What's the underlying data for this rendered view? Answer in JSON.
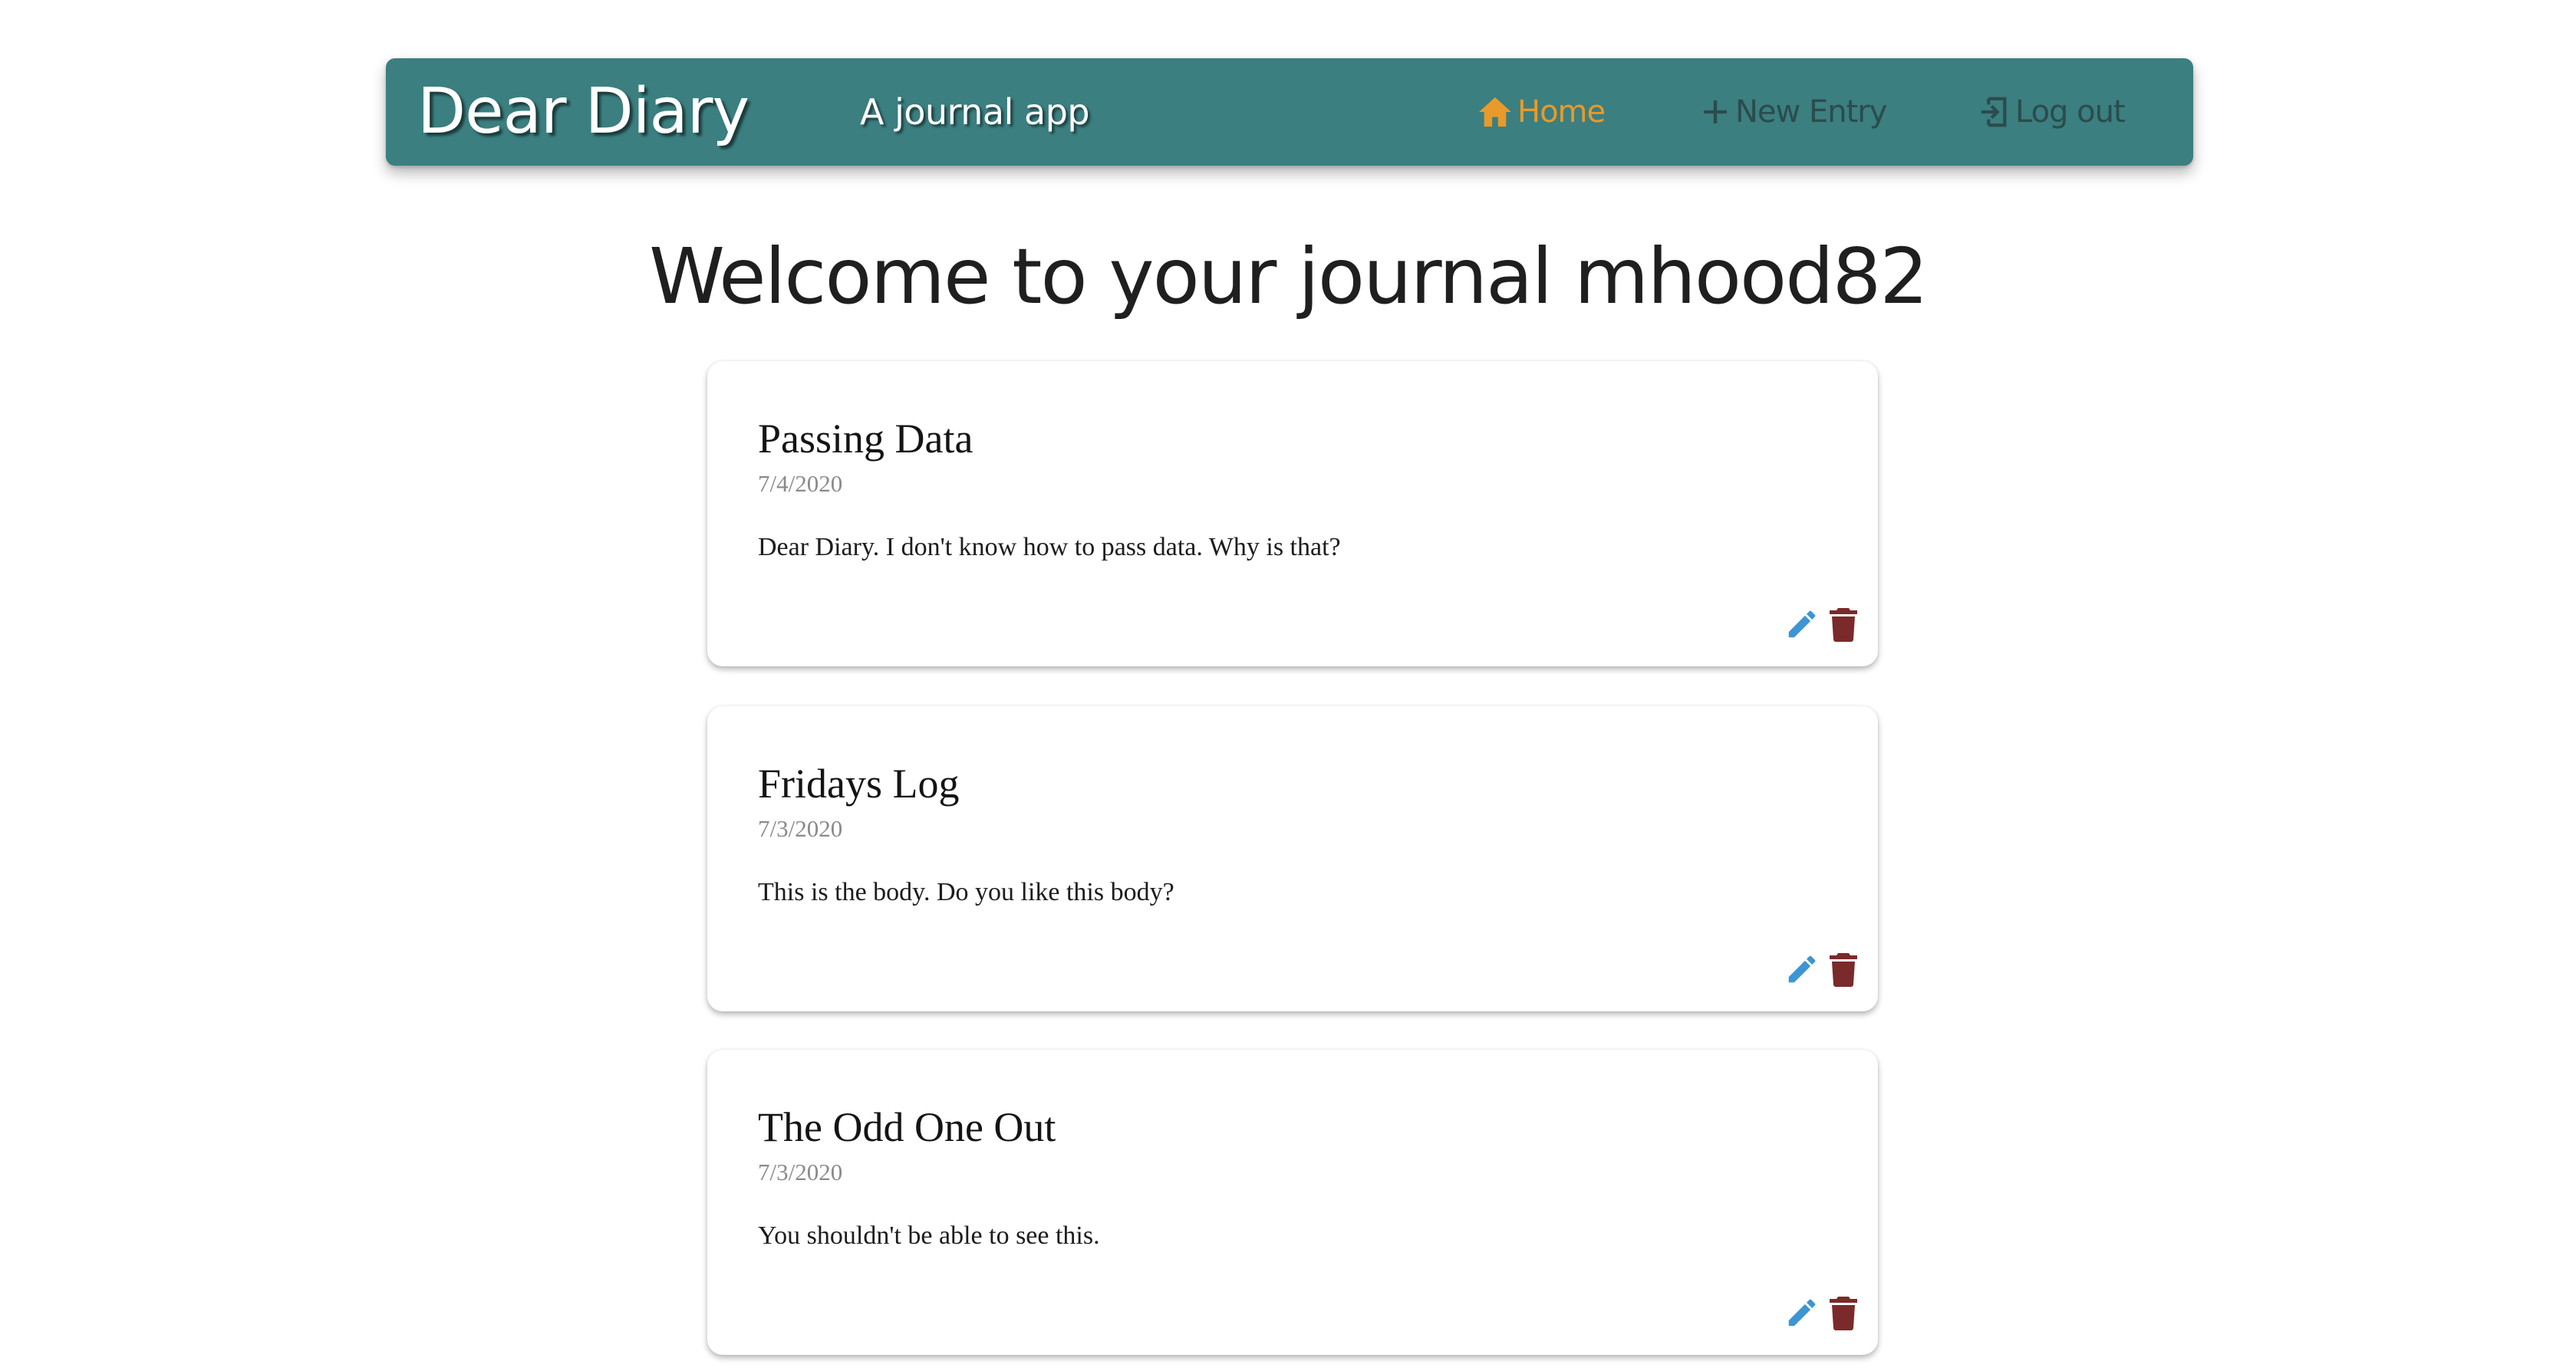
{
  "header": {
    "brand": "Dear Diary",
    "tagline": "A journal app",
    "nav": {
      "home": {
        "label": "Home",
        "icon": "home-icon",
        "active": true
      },
      "new_entry": {
        "label": "New Entry",
        "icon": "plus-icon"
      },
      "logout": {
        "label": "Log out",
        "icon": "logout-icon"
      }
    }
  },
  "main": {
    "title": "Welcome to your journal mhood82",
    "entries": [
      {
        "title": "Passing Data",
        "date": "7/4/2020",
        "body": "Dear Diary. I don't know how to pass data. Why is that?"
      },
      {
        "title": "Fridays Log",
        "date": "7/3/2020",
        "body": "This is the body. Do you like this body?"
      },
      {
        "title": "The Odd One Out",
        "date": "7/3/2020",
        "body": "You shouldn't be able to see this."
      }
    ]
  },
  "colors": {
    "navbar_bg": "#3b7f80",
    "nav_active": "#e89a2a",
    "nav_inactive": "#2c4b4c",
    "edit_icon": "#3d95d3",
    "delete_icon": "#7a2a2a"
  }
}
